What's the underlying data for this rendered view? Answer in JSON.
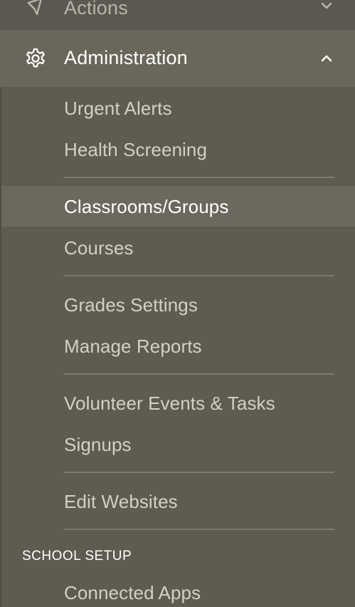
{
  "nav": {
    "actions": {
      "label": "Actions",
      "icon": "megaphone-icon",
      "chevron": "chevron-down-icon"
    },
    "administration": {
      "label": "Administration",
      "icon": "gear-icon",
      "chevron": "chevron-up-icon"
    },
    "items": [
      {
        "label": "Urgent Alerts"
      },
      {
        "label": "Health Screening"
      },
      {
        "label": "Classrooms/Groups",
        "active": true
      },
      {
        "label": "Courses"
      },
      {
        "label": "Grades Settings"
      },
      {
        "label": "Manage Reports"
      },
      {
        "label": "Volunteer Events & Tasks"
      },
      {
        "label": "Signups"
      },
      {
        "label": "Edit Websites"
      }
    ],
    "school_setup": {
      "heading": "SCHOOL SETUP",
      "items": [
        {
          "label": "Connected Apps"
        }
      ]
    }
  },
  "colors": {
    "sidebar_bg": "#5e5c50",
    "header_bg": "#696759",
    "active_bg": "#6b695d",
    "text": "#d3d0c3",
    "text_active": "#ffffff",
    "divider": "#7c7a6d"
  }
}
